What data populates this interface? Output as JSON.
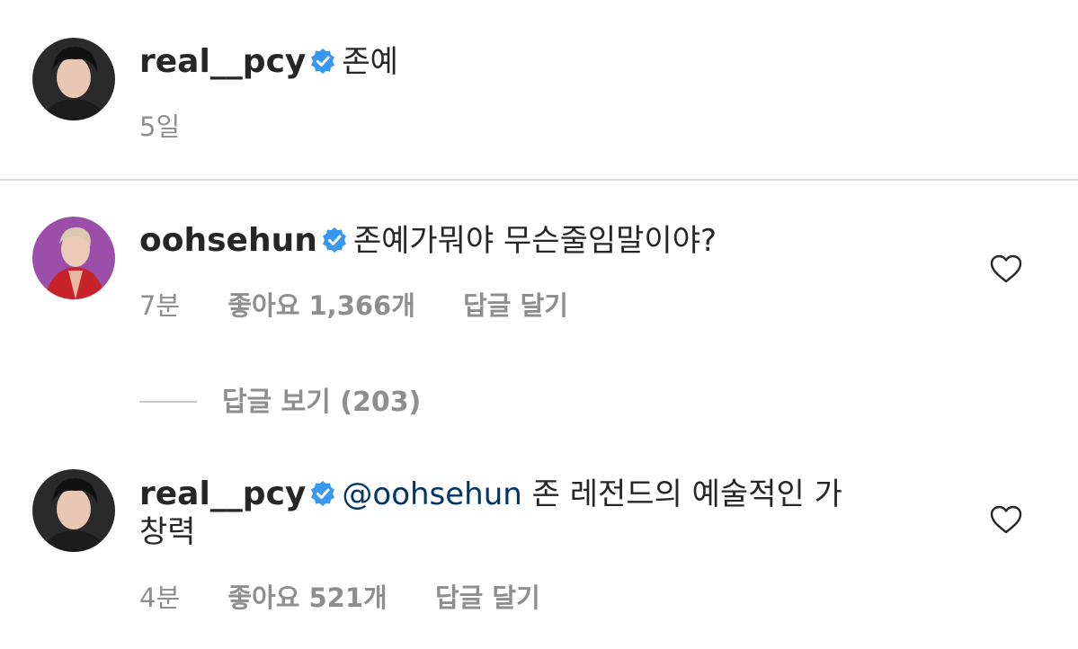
{
  "comments": [
    {
      "username": "real__pcy",
      "text": "존예",
      "time": "5일"
    },
    {
      "username": "oohsehun",
      "text": "존예가뭐야 무슨줄임말이야?",
      "time": "7분",
      "likes": "좋아요 1,366개",
      "reply": "답글 달기"
    },
    {
      "username": "real__pcy",
      "mention": "@oohsehun",
      "text_line1": " 존 레전드의 예술적인 가",
      "text_line2": "창력",
      "time": "4분",
      "likes": "좋아요 521개",
      "reply": "답글 달기"
    }
  ],
  "view_replies": "답글 보기 (203)",
  "colors": {
    "verified": "#3897f0",
    "muted": "#8e8e8e",
    "mention": "#003569",
    "divider": "#dbdbdb"
  }
}
